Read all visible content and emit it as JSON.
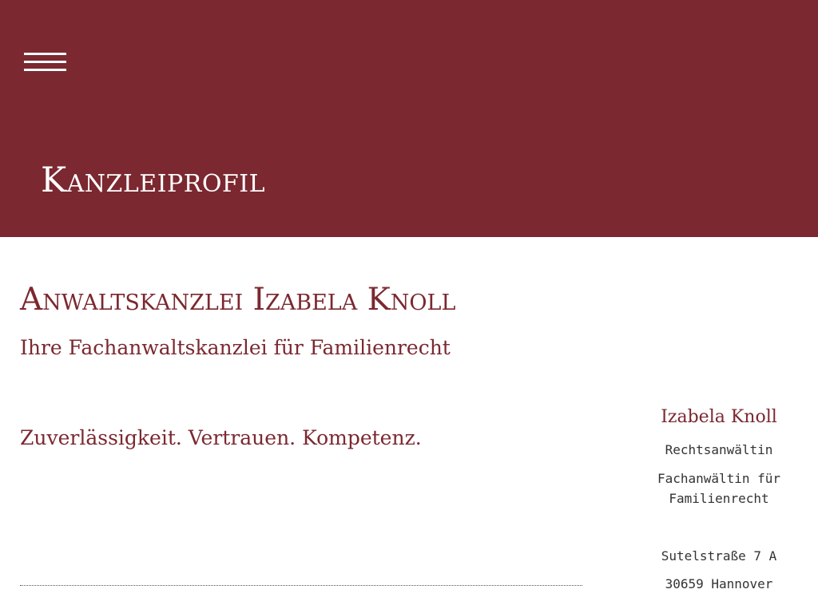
{
  "colors": {
    "brand": "#7b2830",
    "header_text": "#ffffff",
    "body_text": "#333333"
  },
  "header": {
    "menu_icon": "hamburger-menu-icon",
    "title": "Kanzleiprofil"
  },
  "main": {
    "heading": "Anwaltskanzlei Izabela Knoll",
    "subheading": "Ihre Fachanwaltskanzlei für Familienrecht",
    "tagline": "Zuverlässigkeit. Vertrauen. Kompetenz."
  },
  "sidebar": {
    "name": "Izabela Knoll",
    "role": "Rechtsanwältin",
    "specialization": "Fachanwältin für Familienrecht",
    "street": "Sutelstraße 7 A",
    "city": "30659 Hannover"
  }
}
